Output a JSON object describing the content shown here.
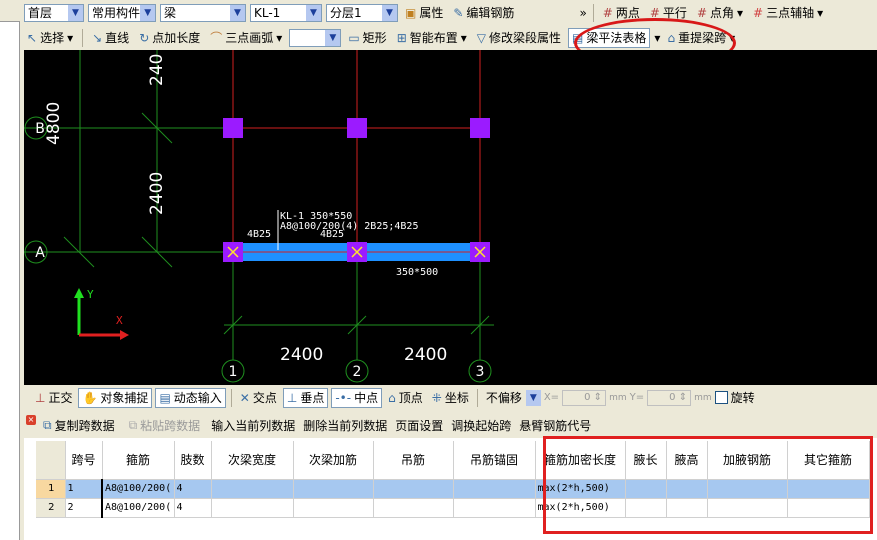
{
  "toolbar1": {
    "floor": "首层",
    "category": "常用构件类",
    "type": "梁",
    "component": "KL-1",
    "layer": "分层1",
    "property": "属性",
    "edit_rebar": "编辑钢筋",
    "two_points": "两点",
    "parallel": "平行",
    "point_angle": "点角",
    "three_point_axis": "三点辅轴"
  },
  "toolbar2": {
    "select": "选择",
    "line": "直线",
    "point_length": "点加长度",
    "arc": "三点画弧",
    "rect": "矩形",
    "smart_layout": "智能布置",
    "modify_span": "修改梁段属性",
    "beam_table": "梁平法表格",
    "re_span": "重提梁跨"
  },
  "canvas": {
    "axis_rows": [
      "A",
      "B"
    ],
    "axis_cols": [
      "1",
      "2",
      "3"
    ],
    "dims": {
      "top_partial": "240",
      "left": "4800",
      "mid_vertical": "2400",
      "bottom_1": "2400",
      "bottom_2": "2400"
    },
    "beam_label": "KL-1 350*550",
    "beam_stirrup": "A8@100/200(4) 2B25;4B25",
    "span_label_1": "4B25",
    "span_label_2": "4B25",
    "section": "350*500",
    "axis_x": "X",
    "axis_y": "Y"
  },
  "snapbar": {
    "ortho": "正交",
    "object_snap": "对象捕捉",
    "dynamic_input": "动态输入",
    "intersection": "交点",
    "perpendicular": "垂点",
    "midpoint": "中点",
    "vertex": "顶点",
    "coordinate": "坐标",
    "offset": "不偏移",
    "x_label": "X=",
    "x_value": "0",
    "y_label": "Y=",
    "y_value": "0",
    "unit": "mm",
    "rotate": "旋转"
  },
  "panel": {
    "copy": "复制跨数据",
    "paste": "粘贴跨数据",
    "input_col": "输入当前列数据",
    "delete_col": "删除当前列数据",
    "page_setup": "页面设置",
    "swap_start": "调换起始跨",
    "cantilever": "悬臂钢筋代号",
    "columns": [
      "跨号",
      "箍筋",
      "肢数",
      "次梁宽度",
      "次梁加筋",
      "吊筋",
      "吊筋锚固",
      "箍筋加密长度",
      "腋长",
      "腋高",
      "加腋钢筋",
      "其它箍筋"
    ],
    "rows": [
      {
        "n": "1",
        "cells": [
          "1",
          "A8@100/200(",
          "4",
          "",
          "",
          "",
          "",
          "max(2*h,500)",
          "",
          "",
          "",
          ""
        ]
      },
      {
        "n": "2",
        "cells": [
          "2",
          "A8@100/200(",
          "4",
          "",
          "",
          "",
          "",
          "max(2*h,500)",
          "",
          "",
          "",
          ""
        ]
      }
    ]
  },
  "colors": {
    "canvas_bg": "#000000",
    "grid": "#1f8f1f",
    "beam": "#1e90ff",
    "column": "#9b1bff",
    "highlight": "#e02020"
  }
}
